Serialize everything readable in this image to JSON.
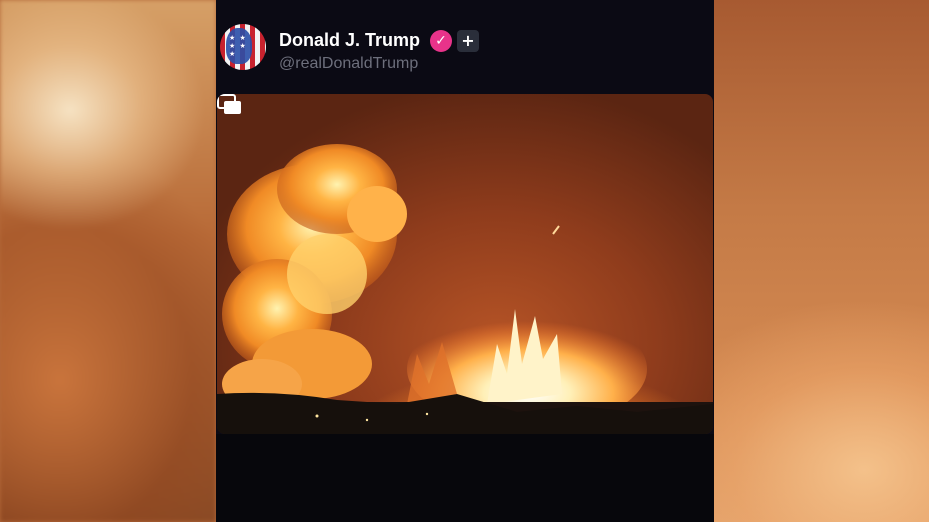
{
  "post": {
    "author_name": "Donald J. Trump",
    "author_handle": "@realDonaldTrump",
    "verified_badge_icon": "verified-check-icon",
    "follow_icon": "plus-icon",
    "avatar_icon": "american-flag-portrait",
    "media": {
      "type": "video",
      "overlay_icon": "gallery-icon"
    }
  },
  "colors": {
    "panel_background": "#0b0a14",
    "name_text": "#ffffff",
    "handle_text": "#6d6f7c",
    "verified_badge": "#e8338a",
    "plus_button": "#2a2e3a"
  }
}
